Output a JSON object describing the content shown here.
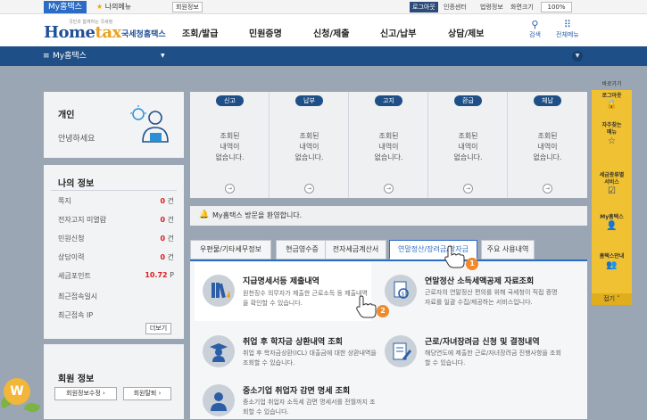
{
  "topbar": {
    "my_tab": "My홈택스",
    "my_menu": "나의메뉴",
    "member_info": "회원정보",
    "logout": "로그아웃",
    "cert_center": "인증센터",
    "legal_info": "법령정보",
    "screen_menu": "화면크기",
    "zoom": "100%"
  },
  "header": {
    "logo_small": "국민과 함께하는 국세청",
    "logo_main_a": "Home",
    "logo_main_b": "tax",
    "logo_sub": "국세청홈택스",
    "nav": [
      "조회/발급",
      "민원증명",
      "신청/제출",
      "신고/납부",
      "상담/제보"
    ],
    "search": "검색",
    "all_menu": "전체메뉴"
  },
  "navbar": {
    "title": "My홈택스"
  },
  "personal": {
    "heading": "개인",
    "greeting": "안녕하세요"
  },
  "my_info": {
    "heading": "나의 정보",
    "rows": [
      {
        "label": "쪽지",
        "value": "0",
        "unit": "건"
      },
      {
        "label": "전자고지 미열람",
        "value": "0",
        "unit": "건"
      },
      {
        "label": "민원신청",
        "value": "0",
        "unit": "건"
      },
      {
        "label": "상담이력",
        "value": "0",
        "unit": "건"
      },
      {
        "label": "세금포인트",
        "value": "10.72",
        "unit": "P"
      },
      {
        "label": "최근접속일시",
        "value": "",
        "unit": ""
      },
      {
        "label": "최근접속 IP",
        "value": "",
        "unit": ""
      }
    ],
    "more": "더보기"
  },
  "member": {
    "heading": "회원 정보",
    "edit": "회원정보수정",
    "withdraw": "회원탈퇴"
  },
  "status": [
    {
      "label": "신고",
      "text": "조회된\n내역이\n없습니다."
    },
    {
      "label": "납부",
      "text": "조회된\n내역이\n없습니다."
    },
    {
      "label": "고지",
      "text": "조회된\n내역이\n없습니다."
    },
    {
      "label": "환급",
      "text": "조회된\n내역이\n없습니다."
    },
    {
      "label": "체납",
      "text": "조회된\n내역이\n없습니다."
    }
  ],
  "welcome": "My홈택스 방문을 환영합니다.",
  "tabs": [
    "우편물/기타세무정보",
    "현금영수증",
    "전자세금계산서",
    "연말정산/장려금/학자금",
    "주요 사용내역"
  ],
  "items": [
    {
      "title": "지급명세서등 제출내역",
      "desc": "원천징수 의무자가 제출한 근로소득 등 제출내역을 확인할 수 있습니다."
    },
    {
      "title": "연말정산 소득세액공제 자료조회",
      "desc": "근로자의 연말정산 편의를 위해 국세청이 직접 증명자료를 일괄 수집/제공하는 서비스입니다."
    },
    {
      "title": "취업 후 학자금 상환내역 조회",
      "desc": "취업 후 학자금상환(ICL) 대출금에 대한 상환내역을 조회할 수 있습니다."
    },
    {
      "title": "근로/자녀장려금 신청 및 결정내역",
      "desc": "해당연도에 제출한 근로/자녀장려금 진행사항을 조회할 수 있습니다."
    },
    {
      "title": "중소기업 취업자 감면 명세 조회",
      "desc": "중소기업 취업자 소득세 감면 명세서를 전월까지 조회할 수 있습니다."
    }
  ],
  "quick": {
    "title": "바로가기",
    "items": [
      "로그아웃",
      "자주찾는\n메뉴",
      "세금종류별\n서비스",
      "My홈택스",
      "홈택스안내"
    ],
    "fold": "접기"
  },
  "badges": [
    "1",
    "2"
  ],
  "coin": "W"
}
